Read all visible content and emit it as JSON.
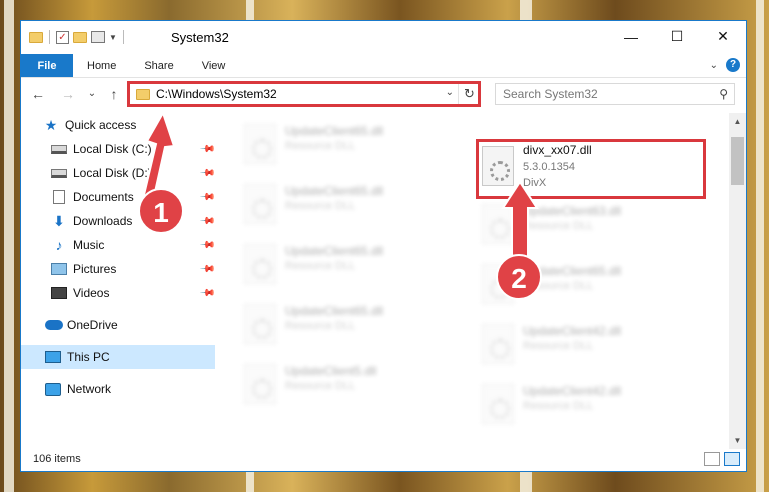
{
  "window": {
    "title": "System32",
    "controls": {
      "minimize": "—",
      "maximize": "☐",
      "close": "✕"
    }
  },
  "ribbon": {
    "tabs": [
      "File",
      "Home",
      "Share",
      "View"
    ],
    "collapse": "⌄",
    "help": "?"
  },
  "nav": {
    "back": "←",
    "forward": "→",
    "recent": "⌄",
    "up": "↑",
    "address": "C:\\Windows\\System32",
    "address_dropdown": "⌄",
    "refresh": "↻",
    "search_placeholder": "Search System32",
    "search_glyph": "⚲"
  },
  "sidebar": {
    "items": [
      {
        "label": "Quick access",
        "icon": "star-icon"
      },
      {
        "label": "Local Disk (C:)",
        "icon": "disk-icon",
        "pinned": true
      },
      {
        "label": "Local Disk (D:)",
        "icon": "disk-icon",
        "pinned": true
      },
      {
        "label": "Documents",
        "icon": "document-icon",
        "pinned": true
      },
      {
        "label": "Downloads",
        "icon": "download-icon",
        "pinned": true
      },
      {
        "label": "Music",
        "icon": "music-icon",
        "pinned": true
      },
      {
        "label": "Pictures",
        "icon": "pictures-icon",
        "pinned": true
      },
      {
        "label": "Videos",
        "icon": "videos-icon",
        "pinned": true
      },
      {
        "label": "OneDrive",
        "icon": "cloud-icon"
      },
      {
        "label": "This PC",
        "icon": "computer-icon",
        "selected": true
      },
      {
        "label": "Network",
        "icon": "network-icon"
      }
    ],
    "pin_glyph": "📌",
    "star_glyph": "★",
    "download_glyph": "⬇",
    "music_glyph": "♪"
  },
  "files": {
    "highlighted": {
      "name": "divx_xx07.dll",
      "version": "5.3.0.1354",
      "company": "DivX"
    },
    "left_column": [
      {
        "name": "UpdateClient65.dll",
        "type": "Resource DLL"
      },
      {
        "name": "UpdateClient65.dll",
        "type": "Resource DLL"
      },
      {
        "name": "UpdateClient65.dll",
        "type": "Resource DLL"
      },
      {
        "name": "UpdateClient65.dll",
        "type": "Resource DLL"
      },
      {
        "name": "UpdateClient5.dll",
        "type": "Resource DLL"
      }
    ],
    "right_column": [
      {
        "name": "UpdateClient63.dll",
        "type": "Resource DLL"
      },
      {
        "name": "UpdateClient65.dll",
        "type": "Resource DLL"
      },
      {
        "name": "UpdateClient42.dll",
        "type": "Resource DLL"
      },
      {
        "name": "UpdateClient42.dll",
        "type": "Resource DLL"
      }
    ]
  },
  "status": {
    "item_count": "106 items"
  },
  "annotations": {
    "step1": "1",
    "step2": "2"
  },
  "colors": {
    "accent": "#1979ca",
    "highlight": "#d9383d",
    "selected": "#cce8ff"
  }
}
